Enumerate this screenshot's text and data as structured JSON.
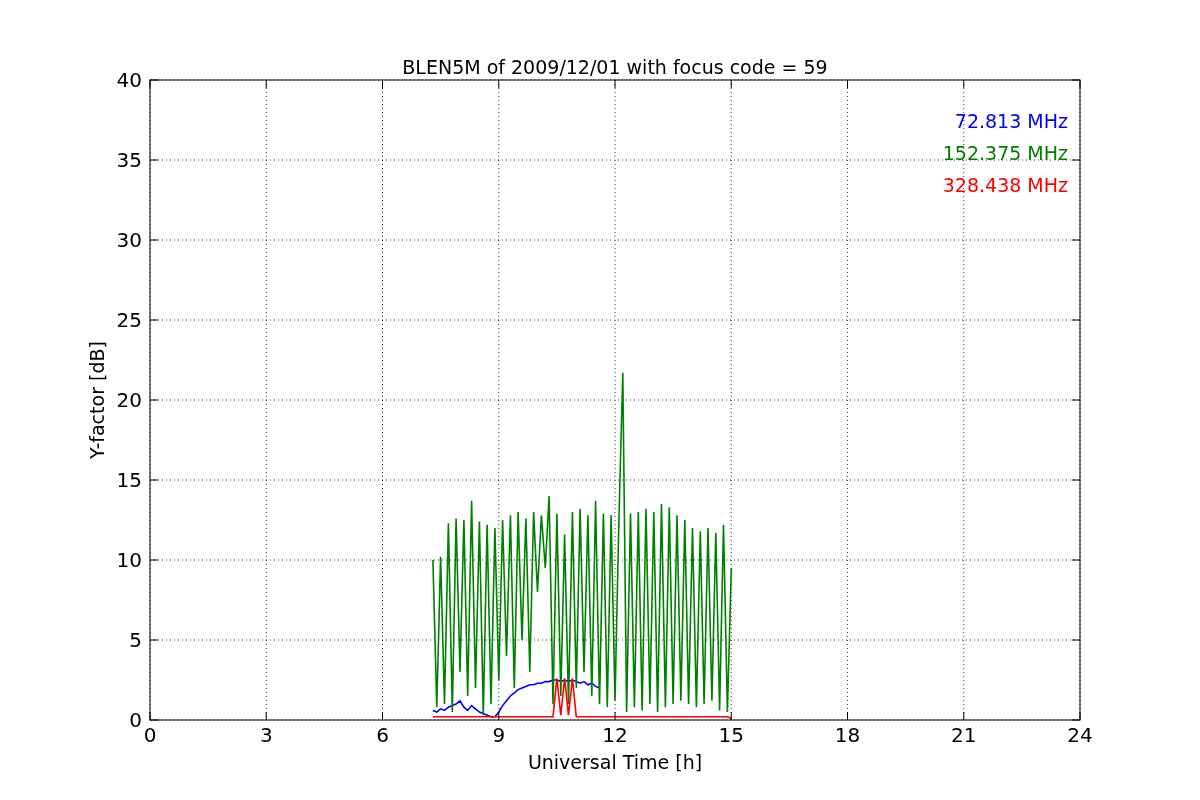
{
  "chart_data": {
    "type": "line",
    "title": "BLEN5M of 2009/12/01 with focus code = 59",
    "xlabel": "Universal Time [h]",
    "ylabel": "Y-factor [dB]",
    "grid": true,
    "xlim": [
      0,
      24
    ],
    "ylim": [
      0,
      40
    ],
    "xticks": [
      0,
      3,
      6,
      9,
      12,
      15,
      18,
      21,
      24
    ],
    "yticks": [
      0,
      5,
      10,
      15,
      20,
      25,
      30,
      35,
      40
    ],
    "x": [
      7.3,
      7.4,
      7.5,
      7.6,
      7.7,
      7.8,
      7.9,
      8.0,
      8.1,
      8.2,
      8.3,
      8.4,
      8.5,
      8.6,
      8.7,
      8.8,
      8.9,
      9.0,
      9.1,
      9.2,
      9.3,
      9.4,
      9.5,
      9.6,
      9.7,
      9.8,
      9.9,
      10.0,
      10.1,
      10.2,
      10.3,
      10.4,
      10.5,
      10.6,
      10.7,
      10.8,
      10.9,
      11.0,
      11.1,
      11.2,
      11.3,
      11.4,
      11.5,
      11.6,
      11.7,
      11.8,
      11.9,
      12.0,
      12.1,
      12.2,
      12.3,
      12.4,
      12.5,
      12.6,
      12.7,
      12.8,
      12.9,
      13.0,
      13.1,
      13.2,
      13.3,
      13.4,
      13.5,
      13.6,
      13.7,
      13.8,
      13.9,
      14.0,
      14.1,
      14.2,
      14.3,
      14.4,
      14.5,
      14.6,
      14.7,
      14.8,
      14.9,
      15.0
    ],
    "series": [
      {
        "name": "72.813 MHz",
        "color": "#0000ff",
        "values": [
          0.6,
          0.5,
          0.7,
          0.6,
          0.8,
          0.9,
          1.0,
          1.2,
          0.8,
          0.6,
          0.9,
          0.7,
          0.5,
          0.4,
          0.3,
          0.2,
          0.2,
          0.5,
          0.9,
          1.2,
          1.5,
          1.7,
          1.9,
          2.0,
          2.1,
          2.2,
          2.2,
          2.3,
          2.3,
          2.4,
          2.4,
          2.5,
          2.5,
          2.4,
          2.5,
          2.4,
          2.5,
          2.4,
          2.3,
          2.4,
          2.2,
          2.3,
          2.1,
          2.0,
          null,
          null,
          null,
          null,
          null,
          null,
          null,
          null,
          null,
          null,
          null,
          null,
          null,
          null,
          null,
          null,
          null,
          null,
          null,
          null,
          null,
          null,
          null,
          null,
          null,
          null,
          null,
          null,
          null,
          null,
          null,
          null,
          null,
          null
        ]
      },
      {
        "name": "152.375 MHz",
        "color": "#008000",
        "values": [
          10,
          0.8,
          10.2,
          1.0,
          12.3,
          0.5,
          12.6,
          3.0,
          12.5,
          1.5,
          13.7,
          2.0,
          12.4,
          0.3,
          12.2,
          1.0,
          12.0,
          2.5,
          12.5,
          4.0,
          12.8,
          2.0,
          13.0,
          5.0,
          12.6,
          3.0,
          13.0,
          8.0,
          12.8,
          9.5,
          14.0,
          1.0,
          12.9,
          1.5,
          11.6,
          1.0,
          13.0,
          2.0,
          13.2,
          3.0,
          12.8,
          1.5,
          13.7,
          1.0,
          12.9,
          0.8,
          12.8,
          1.2,
          12.5,
          21.7,
          0.5,
          12.9,
          0.8,
          13.0,
          0.6,
          13.2,
          1.0,
          13.0,
          0.5,
          13.5,
          0.8,
          13.3,
          1.0,
          12.8,
          1.2,
          12.5,
          1.0,
          12.0,
          0.8,
          11.8,
          1.0,
          12.0,
          1.2,
          11.7,
          0.6,
          12.2,
          0.5,
          9.5
        ]
      },
      {
        "name": "328.438 MHz",
        "color": "#ff0000",
        "values": [
          0.2,
          0.2,
          0.2,
          0.2,
          0.2,
          0.2,
          0.2,
          0.2,
          0.2,
          0.2,
          0.2,
          0.2,
          0.2,
          0.2,
          0.2,
          0.2,
          0.2,
          0.2,
          0.2,
          0.2,
          0.2,
          0.2,
          0.2,
          0.2,
          0.2,
          0.2,
          0.2,
          0.2,
          0.2,
          0.2,
          0.2,
          0.2,
          2.6,
          0.3,
          2.6,
          0.3,
          2.6,
          0.2,
          0.2,
          0.2,
          0.2,
          0.2,
          0.2,
          0.2,
          0.2,
          0.2,
          0.2,
          0.2,
          0.2,
          0.2,
          0.2,
          0.2,
          0.2,
          0.2,
          0.2,
          0.2,
          0.2,
          0.2,
          0.2,
          0.2,
          0.2,
          0.2,
          0.2,
          0.2,
          0.2,
          0.2,
          0.2,
          0.2,
          0.2,
          0.2,
          0.2,
          0.2,
          0.2,
          0.2,
          0.2,
          0.2,
          0.2,
          0.1
        ]
      }
    ]
  }
}
